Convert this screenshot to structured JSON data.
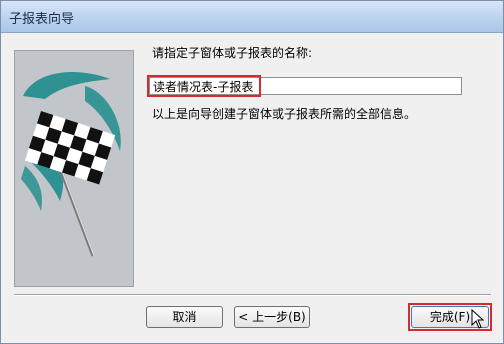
{
  "window": {
    "title": "子报表向导"
  },
  "wizard": {
    "prompt_label": "请指定子窗体或子报表的名称:",
    "name_value": "读者情况表-子报表",
    "info_label": "以上是向导创建子窗体或子报表所需的全部信息。"
  },
  "buttons": {
    "cancel": "取消",
    "back": "< 上一步(B)",
    "finish": "完成(F)"
  },
  "icons": {
    "flag": "checkered-flag-icon",
    "cursor": "mouse-pointer-icon"
  },
  "colors": {
    "highlight": "#d8292c",
    "flag_accent": "#1e8c8c"
  }
}
